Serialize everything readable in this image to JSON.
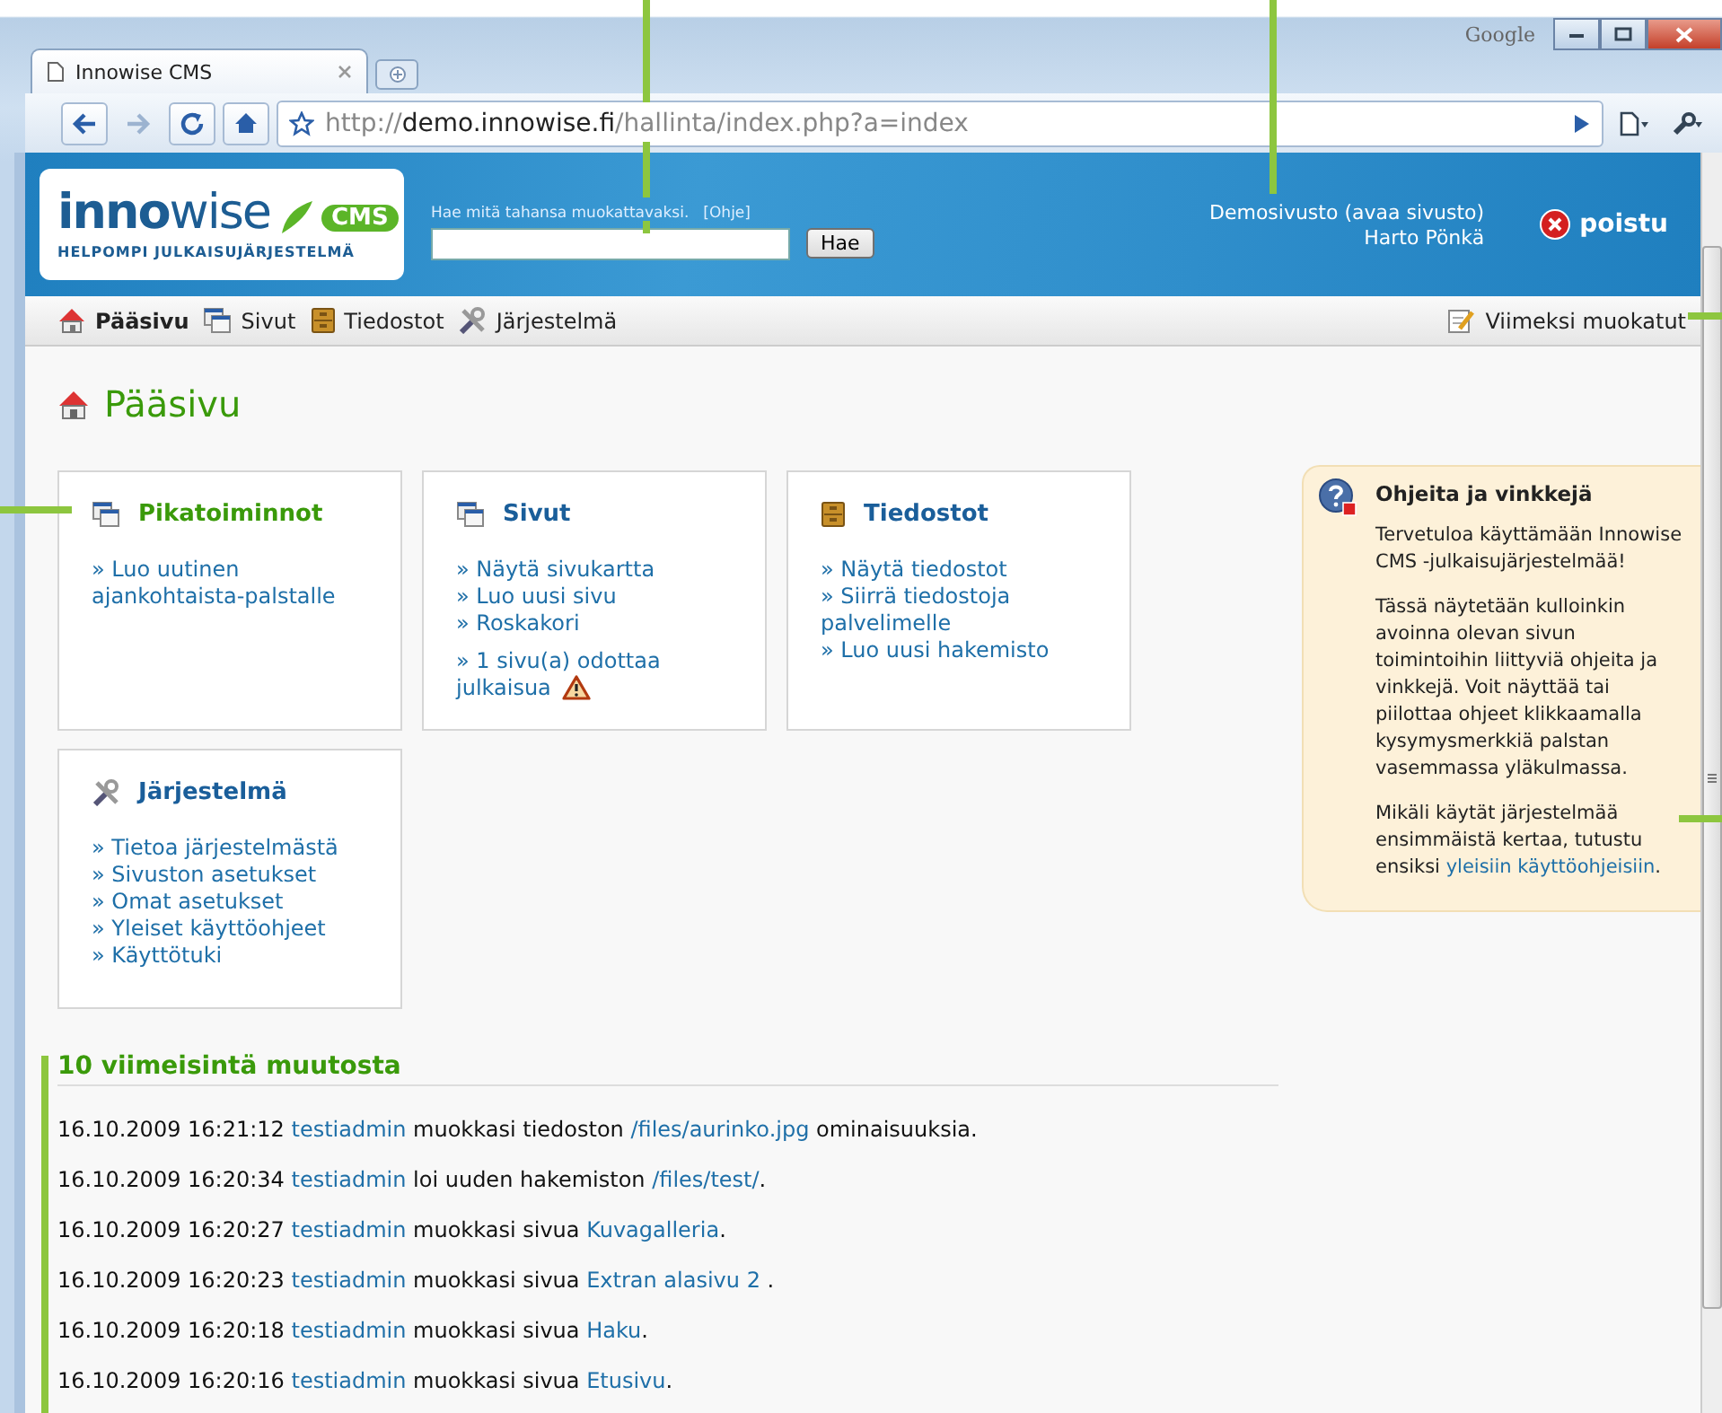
{
  "browser": {
    "tab_title": "Innowise CMS",
    "search_brand": "Google",
    "url_scheme": "http://",
    "url_host": "demo.innowise.fi",
    "url_path": "/hallinta/index.php?a=index"
  },
  "header": {
    "logo_word": "**inno**wise",
    "logo_badge": "CMS",
    "logo_tagline": "HELPOMPI JULKAISUJÄRJESTELMÄ",
    "search_hint": "Hae mitä tahansa muokattavaksi.",
    "help_link": "[Ohje]",
    "search_button": "Hae",
    "site_link": "Demosivusto (avaa sivusto)",
    "user_name": "Harto Pönkä",
    "logout": "poistu"
  },
  "nav": {
    "items": [
      {
        "label": "Pääsivu",
        "kind": "home",
        "selected": true
      },
      {
        "label": "Sivut",
        "kind": "pages",
        "selected": false
      },
      {
        "label": "Tiedostot",
        "kind": "files",
        "selected": false
      },
      {
        "label": "Järjestelmä",
        "kind": "system",
        "selected": false
      }
    ],
    "recent": "Viimeksi muokatut"
  },
  "page_title": "Pääsivu",
  "boxes": [
    {
      "kind": "quick",
      "title": "Pikatoiminnot",
      "links": [
        "» Luo uutinen ajankohtaista-palstalle"
      ]
    },
    {
      "kind": "pages",
      "title": "Sivut",
      "links": [
        "» Näytä sivukartta",
        "» Luo uusi sivu",
        "» Roskakori"
      ],
      "pending": "» 1 sivu(a) odottaa julkaisua"
    },
    {
      "kind": "files",
      "title": "Tiedostot",
      "links": [
        "» Näytä tiedostot",
        "» Siirrä tiedostoja palvelimelle",
        "» Luo uusi hakemisto"
      ]
    },
    {
      "kind": "system",
      "title": "Järjestelmä",
      "links": [
        "» Tietoa järjestelmästä",
        "» Sivuston asetukset",
        "» Omat asetukset",
        "» Yleiset käyttöohjeet",
        "» Käyttötuki"
      ]
    }
  ],
  "help": {
    "title": "Ohjeita ja vinkkejä",
    "paragraphs": [
      {
        "text": "Tervetuloa käyttämään Innowise CMS -julkaisujärjestelmää!"
      },
      {
        "text": "Tässä näytetään kulloinkin avoinna olevan sivun toimintoihin liittyviä ohjeita ja vinkkejä. Voit näyttää tai piilottaa ohjeet klikkaamalla kysymysmerkkiä palstan vasemmassa yläkulmassa."
      },
      {
        "text": "Mikäli käytät järjestelmää ensimmäistä kertaa, tutustu ensiksi ",
        "link": "yleisiin käyttöohjeisiin",
        "end": "."
      }
    ]
  },
  "recent_changes": {
    "title": "10 viimeisintä muutosta",
    "entries": [
      {
        "time": "16.10.2009 16:21:12",
        "user": "testiadmin",
        "action": "muokkasi tiedoston",
        "target": "/files/aurinko.jpg",
        "end": "ominaisuuksia."
      },
      {
        "time": "16.10.2009 16:20:34",
        "user": "testiadmin",
        "action": "loi uuden hakemiston",
        "target": "/files/test/",
        "end": "."
      },
      {
        "time": "16.10.2009 16:20:27",
        "user": "testiadmin",
        "action": "muokkasi sivua",
        "target": "Kuvagalleria",
        "end": "."
      },
      {
        "time": "16.10.2009 16:20:23",
        "user": "testiadmin",
        "action": "muokkasi sivua",
        "target": "Extran alasivu 2",
        "end": " ."
      },
      {
        "time": "16.10.2009 16:20:18",
        "user": "testiadmin",
        "action": "muokkasi sivua",
        "target": "Haku",
        "end": "."
      },
      {
        "time": "16.10.2009 16:20:16",
        "user": "testiadmin",
        "action": "muokkasi sivua",
        "target": "Etusivu",
        "end": "."
      }
    ]
  }
}
